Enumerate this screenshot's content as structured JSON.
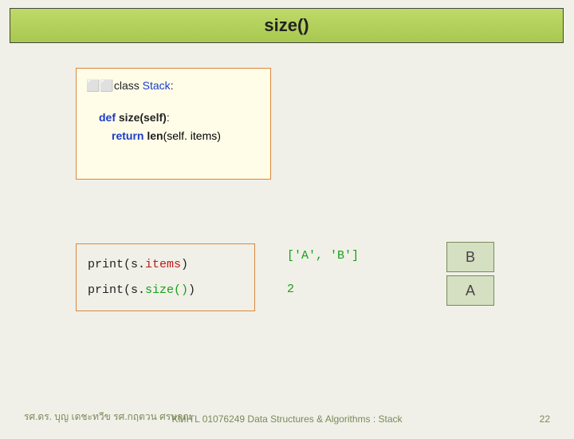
{
  "title": "size()",
  "code": {
    "prefix": "⬜⬜",
    "kw_class": "class",
    "class_name": "Stack",
    "kw_def": "def",
    "method": "size",
    "params": "(self)",
    "kw_return": "return",
    "fn_len": "len",
    "len_arg": "(self. items)"
  },
  "io": {
    "row1_prefix": "print(s.",
    "row1_call": "items",
    "row1_suffix": ")",
    "row2_prefix": "print(s.",
    "row2_call": "size()",
    "row2_suffix": ")"
  },
  "output": {
    "row1": "['A', 'B']",
    "row2": "2"
  },
  "stack": {
    "top": "B",
    "bottom": "A"
  },
  "footer": {
    "left": "รศ.ดร. บุญ     เดชะทวีข     รศ.กฤตวน   ศรษกุณ",
    "center": "KMITL   01076249 Data Structures & Algorithms : Stack",
    "page": "22"
  }
}
